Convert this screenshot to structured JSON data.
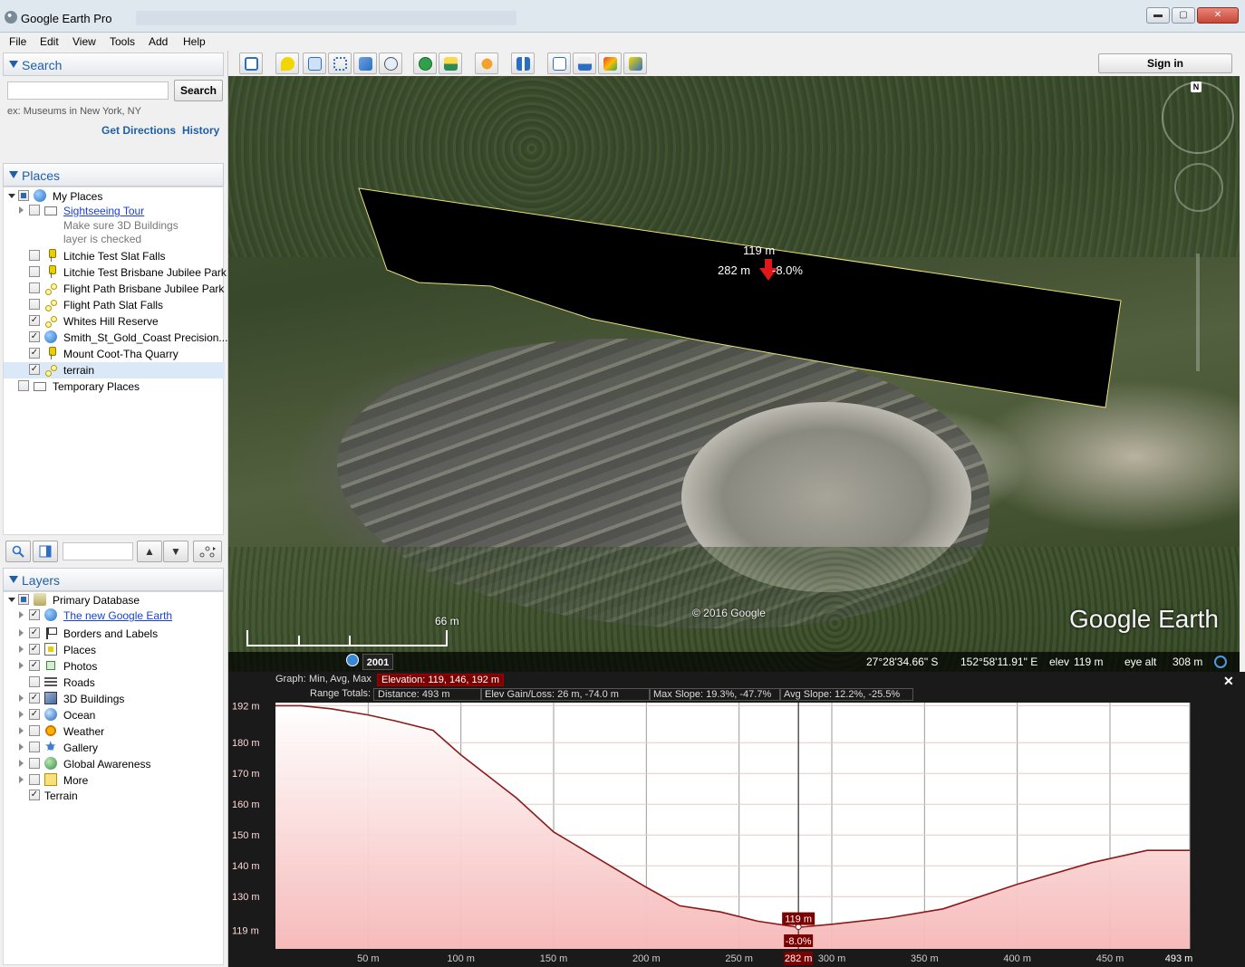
{
  "window": {
    "title": "Google Earth Pro",
    "minimize": "▬",
    "maximize": "▢",
    "close": "✕"
  },
  "menu": [
    "File",
    "Edit",
    "View",
    "Tools",
    "Add",
    "Help"
  ],
  "search": {
    "header": "Search",
    "placeholder": "",
    "button": "Search",
    "hint": "ex: Museums in New York, NY",
    "get_directions": "Get Directions",
    "history": "History"
  },
  "places": {
    "header": "Places",
    "items": [
      {
        "label": "My Places",
        "checked": "partial"
      },
      {
        "label": "Sightseeing Tour",
        "checked": false,
        "link": true,
        "note1": "Make sure 3D Buildings",
        "note2": "layer is checked"
      },
      {
        "label": "Litchie Test Slat Falls",
        "checked": false
      },
      {
        "label": "Litchie Test Brisbane Jubilee Park",
        "checked": false
      },
      {
        "label": "Flight Path Brisbane Jubilee Park",
        "checked": false
      },
      {
        "label": "Flight Path Slat Falls",
        "checked": false
      },
      {
        "label": "Whites Hill Reserve",
        "checked": true
      },
      {
        "label": "Smith_St_Gold_Coast Precision...",
        "checked": true
      },
      {
        "label": "Mount Coot-Tha Quarry",
        "checked": true
      },
      {
        "label": "terrain",
        "checked": true
      },
      {
        "label": "Temporary Places",
        "checked": false
      }
    ]
  },
  "layers": {
    "header": "Layers",
    "items": [
      {
        "label": "Primary Database",
        "checked": "partial"
      },
      {
        "label": "The new Google Earth",
        "checked": true,
        "link": true
      },
      {
        "label": "Borders and Labels",
        "checked": true
      },
      {
        "label": "Places",
        "checked": true
      },
      {
        "label": "Photos",
        "checked": true
      },
      {
        "label": "Roads",
        "checked": false
      },
      {
        "label": "3D Buildings",
        "checked": true
      },
      {
        "label": "Ocean",
        "checked": true
      },
      {
        "label": "Weather",
        "checked": false
      },
      {
        "label": "Gallery",
        "checked": false
      },
      {
        "label": "Global Awareness",
        "checked": false
      },
      {
        "label": "More",
        "checked": false
      },
      {
        "label": "Terrain",
        "checked": true
      }
    ]
  },
  "toolbar": {
    "sign_in": "Sign in"
  },
  "viewport": {
    "profile_top_label": "119 m",
    "profile_dist_label": "282 m",
    "profile_slope_label": "-8.0%",
    "scale": "66 m",
    "copyright": "© 2016 Google",
    "logo": "Google Earth",
    "compass_n": "N",
    "imagery_year": "2001",
    "status": {
      "lat": "27°28'34.66\" S",
      "lon": "152°58'11.91\" E",
      "elev_label": "elev",
      "elev": "119 m",
      "eye_label": "eye alt",
      "eye": "308 m"
    }
  },
  "elevation_profile": {
    "graph_label": "Graph:",
    "graph_modes": "Min, Avg, Max",
    "elevation_tag": "Elevation: 119, 146, 192 m",
    "range_label": "Range Totals:",
    "distance": "Distance: 493 m",
    "gain_loss": "Elev Gain/Loss: 26 m, -74.0 m",
    "max_slope": "Max Slope: 19.3%, -47.7%",
    "avg_slope": "Avg Slope: 12.2%, -25.5%",
    "cursor_elev": "119 m",
    "cursor_slope": "-8.0%",
    "cursor_dist": "282 m",
    "close": "✕"
  },
  "chart_data": {
    "type": "area",
    "title": "",
    "xlabel": "",
    "ylabel": "",
    "xlim": [
      0,
      493
    ],
    "ylim": [
      113,
      193
    ],
    "x_ticks": [
      "50 m",
      "100 m",
      "150 m",
      "200 m",
      "250 m",
      "282 m",
      "300 m",
      "350 m",
      "400 m",
      "450 m",
      "493 m"
    ],
    "y_ticks": [
      "192 m",
      "180 m",
      "170 m",
      "160 m",
      "150 m",
      "140 m",
      "130 m",
      "119 m"
    ],
    "x": [
      0,
      14,
      30,
      50,
      65,
      85,
      100,
      130,
      150,
      175,
      200,
      218,
      240,
      260,
      282,
      300,
      330,
      360,
      400,
      440,
      470,
      493
    ],
    "y": [
      192,
      192,
      191,
      189,
      187,
      184,
      176,
      162,
      151,
      142,
      133,
      127,
      125,
      122,
      120,
      121,
      123,
      126,
      134,
      141,
      145,
      145
    ],
    "cursor": {
      "x": 282,
      "y": 119
    },
    "color": "#8b1a1a",
    "fill": "#f6b7b7",
    "grid": true
  }
}
